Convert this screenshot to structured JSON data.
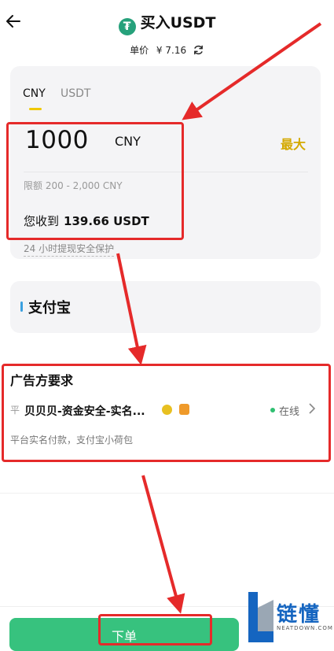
{
  "header": {
    "title": "买入USDT",
    "price_label": "单价",
    "price_value": "¥ 7.16"
  },
  "tabs": [
    {
      "label": "CNY",
      "active": true
    },
    {
      "label": "USDT",
      "active": false
    }
  ],
  "amount": {
    "value": "1000",
    "unit": "CNY",
    "max_label": "最大",
    "limit": "限额 200 - 2,000 CNY",
    "receive_label": "您收到",
    "receive_value": "139.66 USDT",
    "protection": "24 小时提现安全保护"
  },
  "payment": {
    "method": "支付宝"
  },
  "advertiser": {
    "section_title": "广告方要求",
    "prefix": "平",
    "merchant_name": "贝贝贝-资金安全-实名...",
    "status": "在线",
    "note": "平台实名付款，支付宝小荷包"
  },
  "footer": {
    "order_label": "下单"
  },
  "watermark": {
    "brand": "链懂",
    "site": "NEATDOWN.COM"
  },
  "colors": {
    "accent_green": "#37c27e",
    "gold": "#d4a900",
    "annotation_red": "#e52a2a",
    "tether_green": "#26a17b"
  }
}
